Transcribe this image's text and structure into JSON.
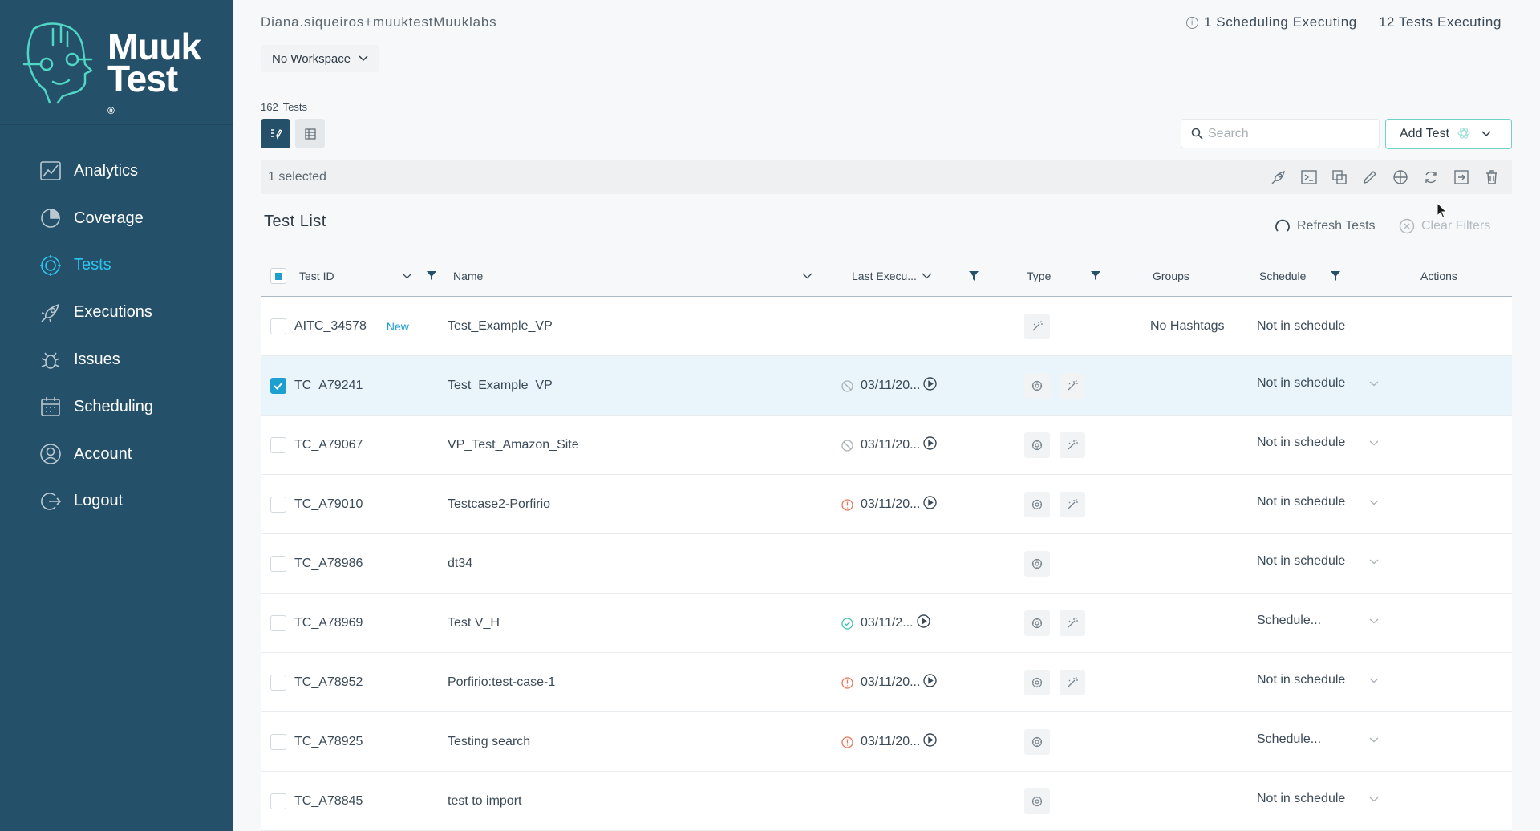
{
  "brand": {
    "line1": "Muuk",
    "line2": "Test",
    "mark": "®"
  },
  "nav": [
    {
      "label": "Analytics",
      "icon": "analytics-icon",
      "active": false
    },
    {
      "label": "Coverage",
      "icon": "coverage-icon",
      "active": false
    },
    {
      "label": "Tests",
      "icon": "tests-icon",
      "active": true
    },
    {
      "label": "Executions",
      "icon": "rocket-icon",
      "active": false
    },
    {
      "label": "Issues",
      "icon": "bug-icon",
      "active": false
    },
    {
      "label": "Scheduling",
      "icon": "calendar-icon",
      "active": false
    },
    {
      "label": "Account",
      "icon": "user-icon",
      "active": false
    },
    {
      "label": "Logout",
      "icon": "logout-icon",
      "active": false
    }
  ],
  "header": {
    "user": "Diana.siqueiros+muuktestMuuklabs",
    "scheduling_executing": "1 Scheduling Executing",
    "tests_executing": "12 Tests Executing",
    "workspace": "No Workspace"
  },
  "tests": {
    "count": "162",
    "count_label": "Tests",
    "search_placeholder": "Search",
    "add_test": "Add Test",
    "selected_text": "1 selected",
    "list_title": "Test List",
    "refresh": "Refresh Tests",
    "clear_filters": "Clear Filters"
  },
  "table": {
    "columns": {
      "test_id": "Test ID",
      "name": "Name",
      "last_execution": "Last Execu...",
      "type": "Type",
      "groups": "Groups",
      "schedule": "Schedule",
      "actions": "Actions"
    },
    "rows": [
      {
        "id": "AITC_34578",
        "badge": "New",
        "name": "Test_Example_VP",
        "exec_status": "",
        "exec_date": "",
        "type_icons": [
          "magic-wand-icon"
        ],
        "groups": "No Hashtags",
        "schedule": "Not in schedule",
        "schedule_dropdown": false,
        "checked": false
      },
      {
        "id": "TC_A79241",
        "badge": "",
        "name": "Test_Example_VP",
        "exec_status": "cancelled",
        "exec_date": "03/11/20...",
        "type_icons": [
          "gear-icon",
          "magic-wand-icon"
        ],
        "groups": "",
        "schedule": "Not in schedule",
        "schedule_dropdown": true,
        "checked": true
      },
      {
        "id": "TC_A79067",
        "badge": "",
        "name": "VP_Test_Amazon_Site",
        "exec_status": "cancelled",
        "exec_date": "03/11/20...",
        "type_icons": [
          "gear-icon",
          "magic-wand-icon"
        ],
        "groups": "",
        "schedule": "Not in schedule",
        "schedule_dropdown": true,
        "checked": false
      },
      {
        "id": "TC_A79010",
        "badge": "",
        "name": "Testcase2-Porfirio",
        "exec_status": "error",
        "exec_date": "03/11/20...",
        "type_icons": [
          "gear-icon",
          "magic-wand-icon"
        ],
        "groups": "",
        "schedule": "Not in schedule",
        "schedule_dropdown": true,
        "checked": false
      },
      {
        "id": "TC_A78986",
        "badge": "",
        "name": "dt34",
        "exec_status": "",
        "exec_date": "",
        "type_icons": [
          "gear-icon"
        ],
        "groups": "",
        "schedule": "Not in schedule",
        "schedule_dropdown": true,
        "checked": false
      },
      {
        "id": "TC_A78969",
        "badge": "",
        "name": "Test V_H",
        "exec_status": "success",
        "exec_date": "03/11/2...",
        "type_icons": [
          "gear-icon",
          "magic-wand-icon"
        ],
        "groups": "",
        "schedule": "Schedule...",
        "schedule_dropdown": true,
        "checked": false
      },
      {
        "id": "TC_A78952",
        "badge": "",
        "name": "Porfirio:test-case-1",
        "exec_status": "error",
        "exec_date": "03/11/20...",
        "type_icons": [
          "gear-icon",
          "magic-wand-icon"
        ],
        "groups": "",
        "schedule": "Not in schedule",
        "schedule_dropdown": true,
        "checked": false
      },
      {
        "id": "TC_A78925",
        "badge": "",
        "name": "Testing search",
        "exec_status": "error",
        "exec_date": "03/11/20...",
        "type_icons": [
          "gear-icon"
        ],
        "groups": "",
        "schedule": "Schedule...",
        "schedule_dropdown": true,
        "checked": false
      },
      {
        "id": "TC_A78845",
        "badge": "",
        "name": "test to import",
        "exec_status": "",
        "exec_date": "",
        "type_icons": [
          "gear-icon"
        ],
        "groups": "",
        "schedule": "Not in schedule",
        "schedule_dropdown": true,
        "checked": false
      }
    ]
  },
  "colors": {
    "sidebar": "#245069",
    "accent": "#2ec4f0",
    "checkbox": "#1d9fd0",
    "error": "#e8765a",
    "success": "#3fc3a7"
  }
}
